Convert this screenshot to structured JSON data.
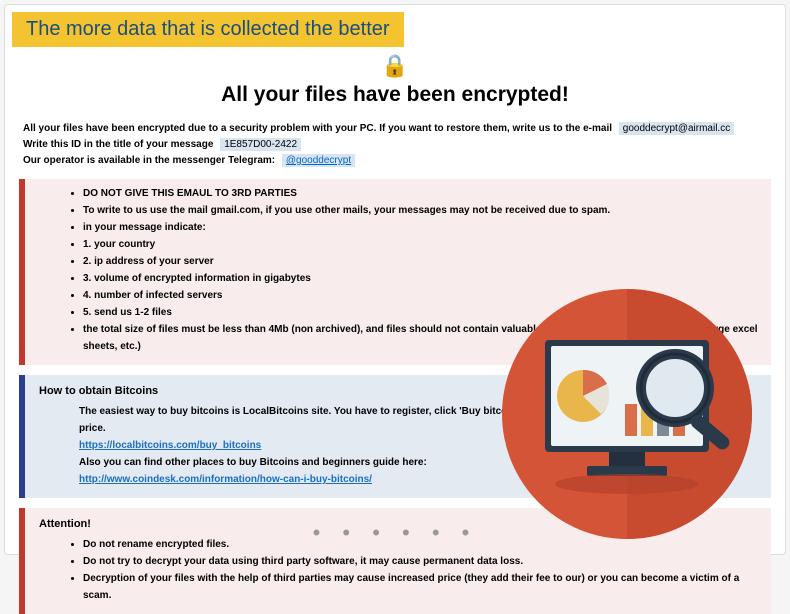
{
  "banner": "The more data that is collected the better",
  "headline": "All your files have been encrypted!",
  "intro": {
    "line1_prefix": "All your files have been encrypted due to a security problem with your PC. If you want to restore them, write us to the e-mail",
    "email": "gooddecrypt@airmail.cc",
    "line2_prefix": "Write this ID in the title of your message",
    "id": "1E857D00-2422",
    "line3_prefix": "Our operator is available in the messenger Telegram:",
    "telegram": "@gooddecrypt"
  },
  "rules": [
    "DO NOT GIVE THIS EMAUL TO 3RD PARTIES",
    "To write to us use the mail gmail.com, if you use other mails, your messages may not be received due to spam.",
    "in your message indicate:",
    "1. your country",
    "2. ip address of your server",
    "3. volume of encrypted information in gigabytes",
    "4. number of infected servers",
    "5. send us 1-2 files",
    "the total size of files must be less than 4Mb (non archived), and files should not contain valuable information (databases, backups, large excel sheets, etc.)"
  ],
  "bitcoin": {
    "title": "How to obtain Bitcoins",
    "line1": "The easiest way to buy bitcoins is LocalBitcoins site. You have to register, click 'Buy bitcoins', and select the seller by payment method and price.",
    "link1": "https://localbitcoins.com/buy_bitcoins",
    "line2": "Also you can find other places to buy Bitcoins and beginners guide here:",
    "link2": "http://www.coindesk.com/information/how-can-i-buy-bitcoins/"
  },
  "attention": {
    "title": "Attention!",
    "items": [
      "Do not rename encrypted files.",
      "Do not try to decrypt your data using third party software, it may cause permanent data loss.",
      "Decryption of your files with the help of third parties may cause increased price (they add their fee to our) or you can become a victim of a scam."
    ]
  },
  "dots": "• • • • • •"
}
